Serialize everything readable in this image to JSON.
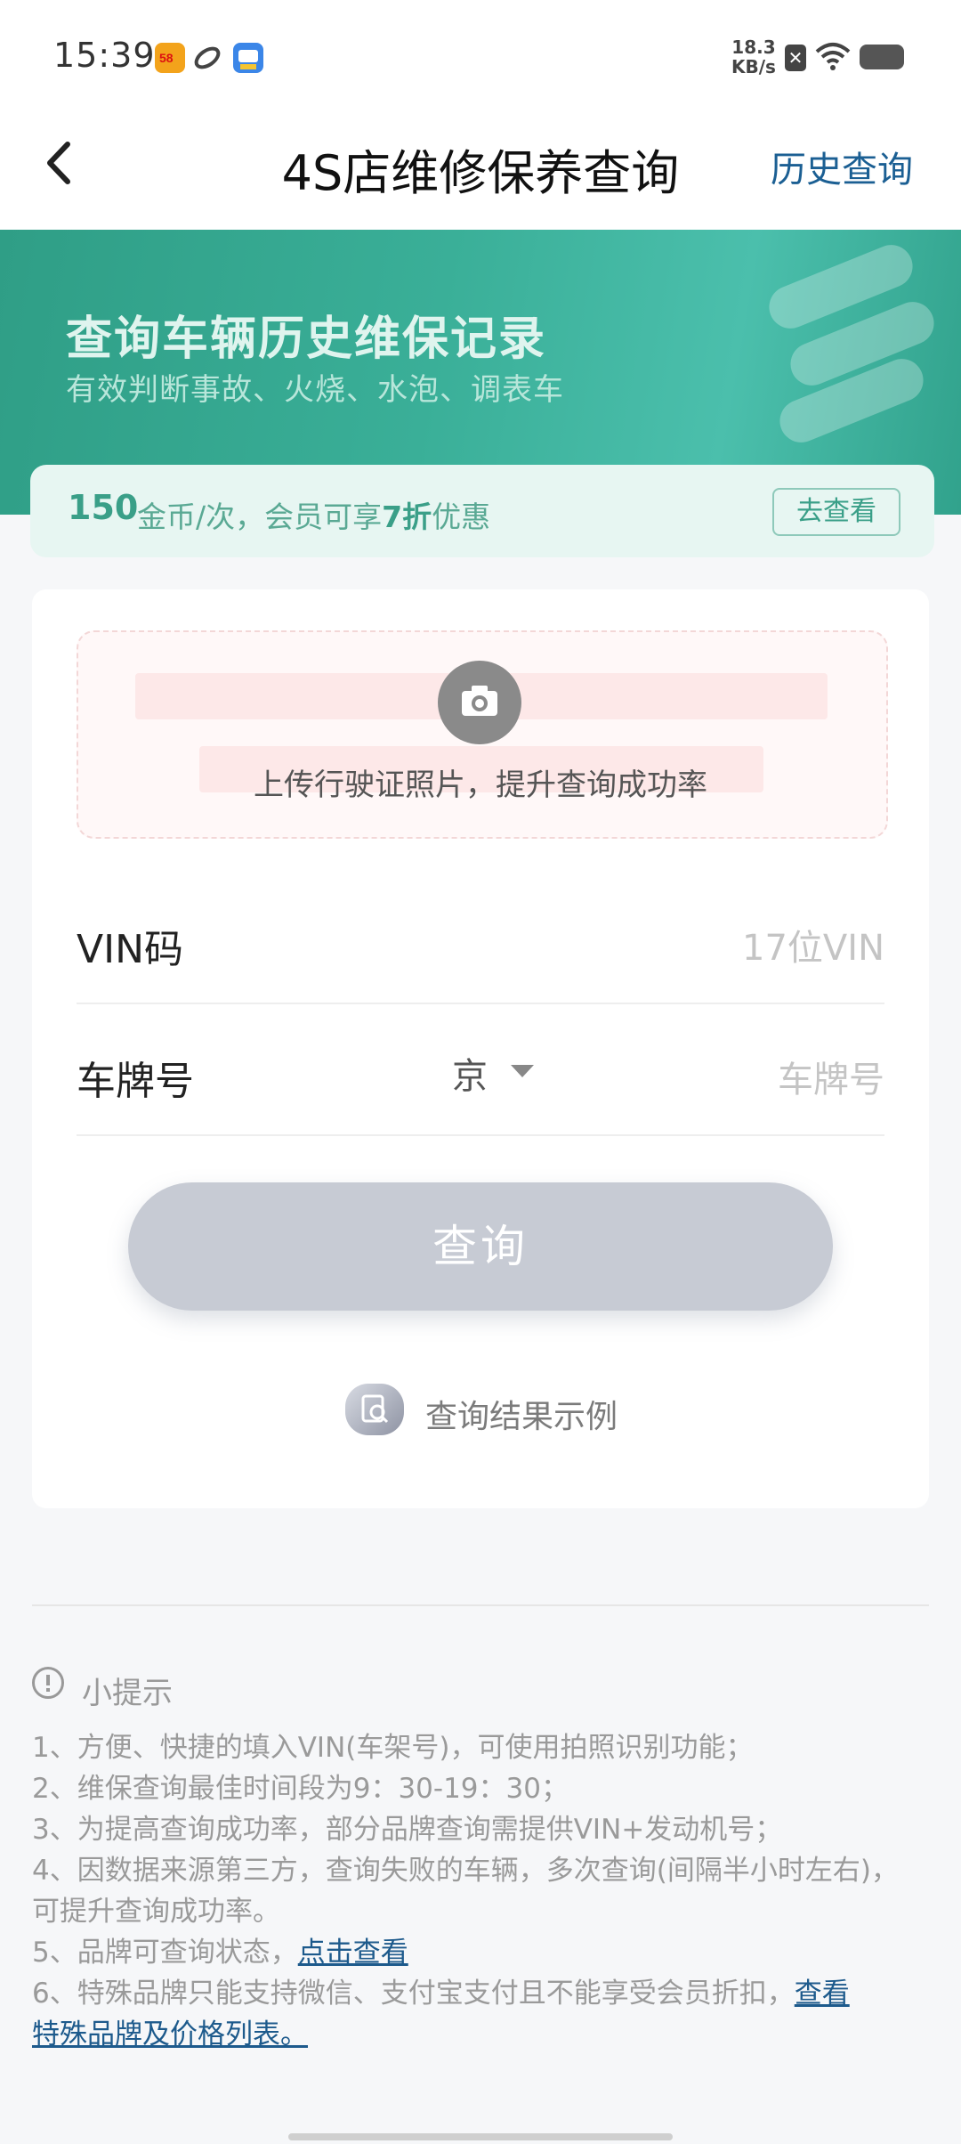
{
  "status_bar": {
    "time": "15:39",
    "net_speed_value": "18.3",
    "net_speed_unit": "KB/s",
    "app_icons": [
      "58-app-icon",
      "orbit-app-icon",
      "bus-app-icon"
    ]
  },
  "nav": {
    "title": "4S店维修保养查询",
    "history_label": "历史查询"
  },
  "banner": {
    "title": "查询车辆历史维保记录",
    "subtitle": "有效判断事故、火烧、水泡、调表车"
  },
  "promo": {
    "price": "150",
    "text_prefix": " 金币/次，会员可享",
    "discount": "7折",
    "text_suffix": "优惠",
    "button_label": "去查看"
  },
  "upload": {
    "hint": "上传行驶证照片，提升查询成功率"
  },
  "form": {
    "vin_label": "VIN码",
    "vin_placeholder": "17位VIN",
    "plate_label": "车牌号",
    "plate_province": "京",
    "plate_placeholder": "车牌号",
    "query_label": "查询"
  },
  "example": {
    "label": "查询结果示例"
  },
  "tips": {
    "title": "小提示",
    "items": [
      "1、方便、快捷的填入VIN(车架号)，可使用拍照识别功能；",
      "2、维保查询最佳时间段为9：30-19：30；",
      "3、为提高查询成功率，部分品牌查询需提供VIN+发动机号；",
      "4、因数据来源第三方，查询失败的车辆，多次查询(间隔半小时左右)，",
      "可提升查询成功率。"
    ],
    "item5_prefix": "5、品牌可查询状态，",
    "item5_link": "点击查看",
    "item6_prefix": "6、特殊品牌只能支持微信、支付宝支付且不能享受会员折扣，",
    "item6_link_a": "查看",
    "item6_link_b": "特殊品牌及价格列表。"
  },
  "colors": {
    "accent_teal": "#3aaf98",
    "link_blue": "#1d5a8c",
    "button_disabled": "#c7cbd4"
  }
}
